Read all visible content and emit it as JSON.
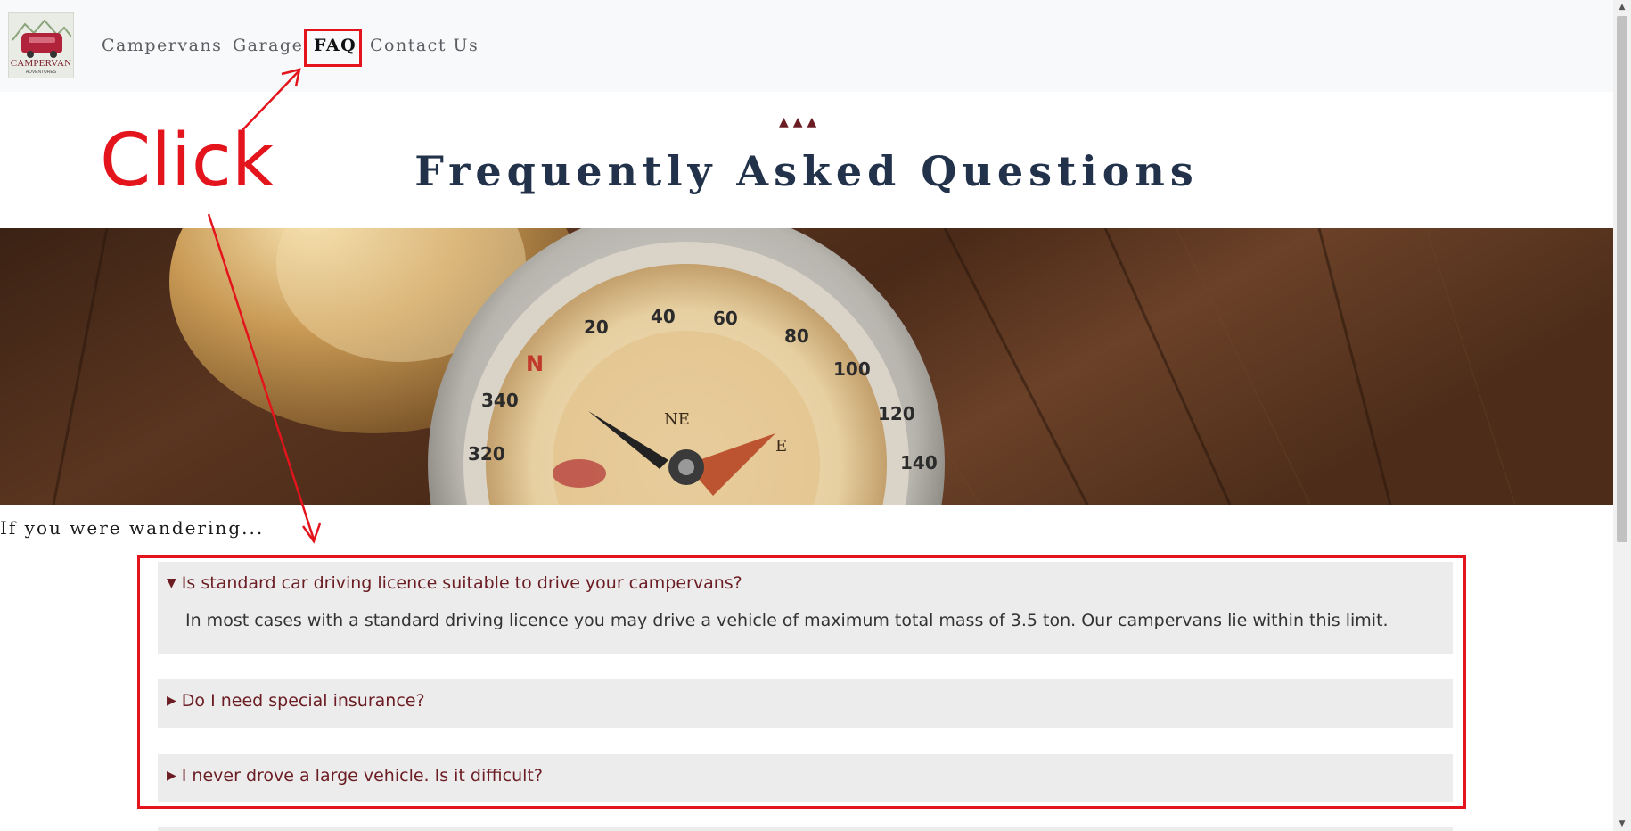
{
  "nav": {
    "logo_text": "CAMPERVAN",
    "logo_subtext": "ADVENTURES",
    "links": [
      {
        "label": "Campervans",
        "active": false
      },
      {
        "label": "Garage",
        "active": false
      },
      {
        "label": "FAQ",
        "active": true
      },
      {
        "label": "Contact Us",
        "active": false
      }
    ]
  },
  "header": {
    "divider": "▲▲▲",
    "title": "Frequently Asked Questions"
  },
  "hero": {
    "image": "compass-on-wooden-table",
    "dial_numbers": [
      "20",
      "40",
      "60",
      "80",
      "100",
      "120",
      "140",
      "320",
      "340"
    ],
    "dial_letters": [
      "N",
      "NE",
      "E"
    ]
  },
  "intro": "If you were wandering...",
  "faq": [
    {
      "question": "Is standard car driving licence suitable to drive your campervans?",
      "answer": "In most cases with a standard driving licence you may drive a vehicle of maximum total mass of 3.5 ton. Our campervans lie within this limit.",
      "expanded": true,
      "arrow": "▼"
    },
    {
      "question": "Do I need special insurance?",
      "expanded": false,
      "arrow": "▶"
    },
    {
      "question": "I never drove a large vehicle. Is it difficult?",
      "expanded": false,
      "arrow": "▶"
    }
  ],
  "annotation": {
    "label": "Click",
    "color": "#e3141c"
  },
  "colors": {
    "accent": "#6b1d23",
    "title": "#22324a",
    "faq_bg": "#ececec",
    "navbar_bg": "#f8f9fa"
  }
}
